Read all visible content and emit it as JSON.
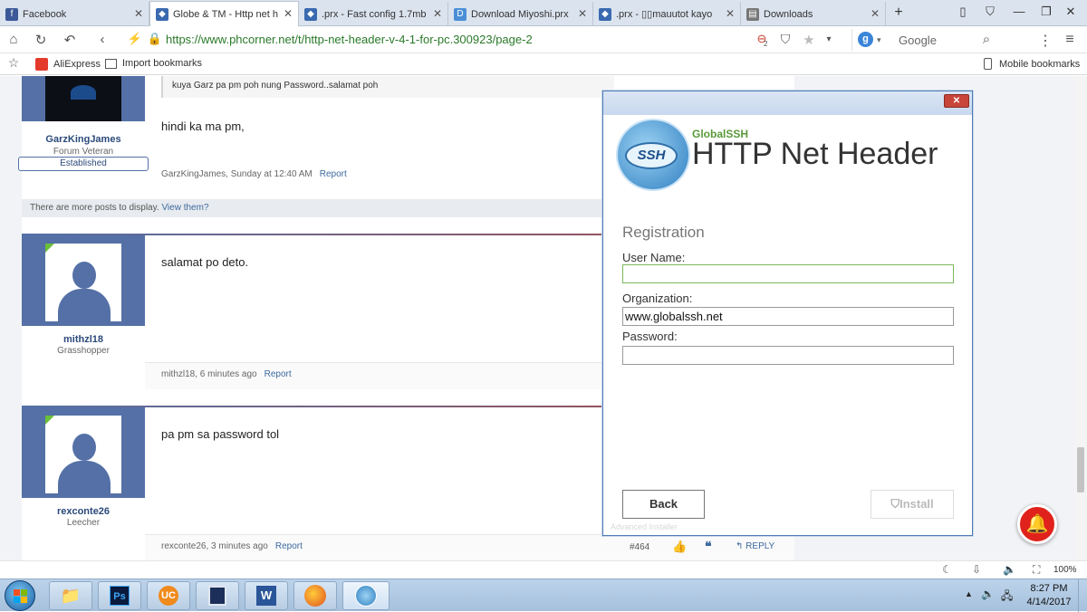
{
  "tabs": [
    {
      "label": "Facebook",
      "icon": "facebook-icon",
      "color": "#3b5998",
      "glyph": "f"
    },
    {
      "label": "Globe & TM - Http net h",
      "icon": "shield-favicon-icon",
      "color": "#3a6ab0",
      "glyph": "◆"
    },
    {
      "label": ".prx - Fast config 1.7mb",
      "icon": "shield-favicon-icon",
      "color": "#3a6ab0",
      "glyph": "◆"
    },
    {
      "label": "Download Miyoshi.prx",
      "icon": "d-favicon-icon",
      "color": "#4a8fd6",
      "glyph": "D"
    },
    {
      "label": ".prx - ▯▯mauutot kayo",
      "icon": "shield-favicon-icon",
      "color": "#3a6ab0",
      "glyph": "◆"
    },
    {
      "label": "Downloads",
      "icon": "downloads-icon",
      "color": "#777",
      "glyph": "▤"
    }
  ],
  "address_bar": {
    "url": "https://www.phcorner.net/t/http-net-header-v-4-1-for-pc.300923/page-2",
    "search_engine": "Google",
    "badge_count": "2"
  },
  "bookmarks": {
    "items": [
      "AliExpress",
      "Import bookmarks"
    ],
    "mobile": "Mobile bookmarks"
  },
  "posts": [
    {
      "username": "GarzKingJames",
      "user_title": "Forum Veteran",
      "badge": "Established",
      "quote": "kuya Garz pa pm poh nung Password..salamat poh",
      "message": "hindi ka ma pm,",
      "meta_author": "GarzKingJames, Sunday at 12:40 AM",
      "report": "Report"
    },
    {
      "username": "mithzl18",
      "user_title": "Grasshopper",
      "message": "salamat po deto.",
      "meta_author": "mithzl18, 6 minutes ago",
      "report": "Report"
    },
    {
      "username": "rexconte26",
      "user_title": "Leecher",
      "message": "pa pm sa password tol",
      "meta_author": "rexconte26, 3 minutes ago",
      "report": "Report",
      "post_number": "#464",
      "reply": "REPLY"
    }
  ],
  "more_posts": {
    "text": "There are more posts to display.",
    "link": "View them?"
  },
  "dialog": {
    "brand": "GlobalSSH",
    "title": "HTTP Net Header",
    "logo_text": "SSH",
    "section": "Registration",
    "fields": {
      "username_label": "User Name:",
      "username_value": "",
      "organization_label": "Organization:",
      "organization_value": "www.globalssh.net",
      "password_label": "Password:",
      "password_value": ""
    },
    "back_label": "Back",
    "install_label": "Install",
    "faded_footer": "Advanced Installer"
  },
  "statusbar": {
    "zoom": "100%"
  },
  "taskbar": {
    "time": "8:27 PM",
    "date": "4/14/2017"
  },
  "colors": {
    "accent_blue": "#5470a6",
    "notification_red": "#e0221c",
    "url_green": "#2a7a2a",
    "link_blue": "#3d6aa0"
  }
}
